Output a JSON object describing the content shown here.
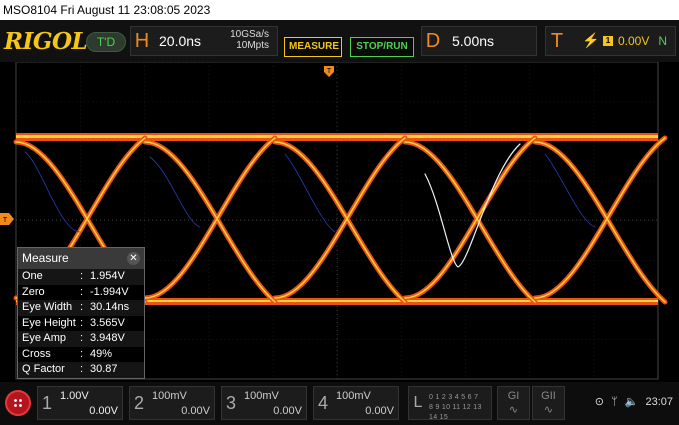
{
  "title_bar": {
    "text": "MSO8104  Fri August 11 23:08:05 2023"
  },
  "brand": {
    "logo": "RIGOL",
    "td_label": "T'D"
  },
  "horizontal": {
    "letter": "H",
    "timebase": "20.0ns",
    "sample_rate": "10GSa/s",
    "memory": "10Mpts"
  },
  "buttons": {
    "measure": "MEASURE",
    "stop_run": "STOP/RUN"
  },
  "delay": {
    "letter": "D",
    "value": "5.00ns"
  },
  "trigger": {
    "letter": "T",
    "slope_icon": "rising-edge-icon",
    "source": "1",
    "level": "0.00V",
    "mode": "N"
  },
  "markers": {
    "trigger_position": "T",
    "trigger_level": "T"
  },
  "measure_panel": {
    "title": "Measure",
    "close": "✕",
    "rows": [
      {
        "label": "One",
        "value": "1.954V"
      },
      {
        "label": "Zero",
        "value": "-1.994V"
      },
      {
        "label": "Eye Width",
        "value": "30.14ns"
      },
      {
        "label": "Eye Height",
        "value": "3.565V"
      },
      {
        "label": "Eye Amp",
        "value": "3.948V"
      },
      {
        "label": "Cross",
        "value": "49%"
      },
      {
        "label": "Q Factor",
        "value": "30.87"
      }
    ]
  },
  "channels": [
    {
      "num": "1",
      "scale": "1.00V",
      "offset": "0.00V"
    },
    {
      "num": "2",
      "scale": "100mV",
      "offset": "0.00V"
    },
    {
      "num": "3",
      "scale": "100mV",
      "offset": "0.00V"
    },
    {
      "num": "4",
      "scale": "100mV",
      "offset": "0.00V"
    }
  ],
  "logic": {
    "num": "L",
    "digits_top": "0 1 2 3  4 5 6 7",
    "digits_bottom": "8 9 10 11 12 13 14 15"
  },
  "generators": [
    {
      "label": "GI"
    },
    {
      "label": "GII"
    }
  ],
  "status": {
    "time": "23:07"
  },
  "colors": {
    "ch1_trace": "#f08a1c",
    "accent": "#f5c518",
    "run_green": "#4fd14f",
    "home": "#b3141e"
  }
}
